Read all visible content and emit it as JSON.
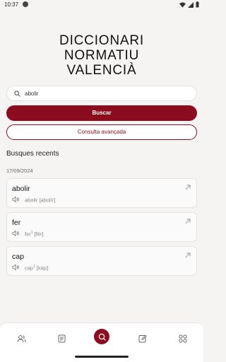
{
  "status_bar": {
    "time": "10:37"
  },
  "title": {
    "line1": "DICCIONARI",
    "line2": "NORMATIU",
    "line3": "VALENCIÀ"
  },
  "search": {
    "value": "abolir"
  },
  "buttons": {
    "search_label": "Buscar",
    "advanced_label": "Consulta avançada"
  },
  "recent": {
    "heading": "Busques recents",
    "date": "17/09/2024",
    "items": [
      {
        "word": "abolir",
        "pron_prefix": "abolir",
        "pron_sup": "",
        "pron_phon": "[abolír]"
      },
      {
        "word": "fer",
        "pron_prefix": "fer",
        "pron_sup": "1",
        "pron_phon": "[fér]"
      },
      {
        "word": "cap",
        "pron_prefix": "cap",
        "pron_sup": "1",
        "pron_phon": "[kàp]"
      }
    ]
  },
  "colors": {
    "accent": "#8a0c1e",
    "background": "#f5f4f3"
  },
  "bottom_nav": {
    "icons": [
      "users-icon",
      "document-icon",
      "search-icon",
      "edit-icon",
      "grid-icon"
    ]
  }
}
